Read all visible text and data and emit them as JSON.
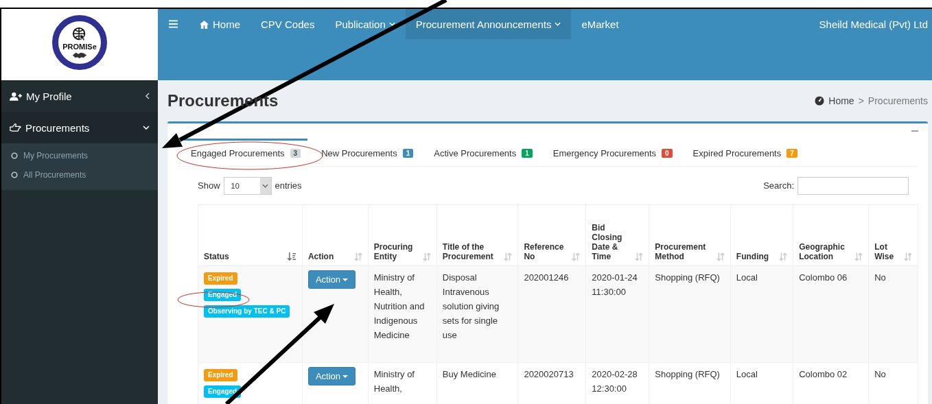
{
  "logo": {
    "text": "PROMISe"
  },
  "nav": {
    "items": [
      {
        "label": "Home",
        "kind": "home",
        "selected": false
      },
      {
        "label": "CPV Codes",
        "kind": "link",
        "selected": false
      },
      {
        "label": "Publication",
        "kind": "dropdown",
        "selected": false
      },
      {
        "label": "Procurement Announcements",
        "kind": "dropdown",
        "selected": true
      },
      {
        "label": "eMarket",
        "kind": "link",
        "selected": false
      }
    ],
    "user": "Sheild Medical (Pvt) Ltd"
  },
  "sidebar": {
    "items": [
      {
        "label": "My Profile",
        "kind": "profile",
        "expanded": false
      },
      {
        "label": "Procurements",
        "kind": "hand",
        "expanded": true,
        "children": [
          {
            "label": "My Procurements"
          },
          {
            "label": "All Procurements"
          }
        ]
      }
    ]
  },
  "page": {
    "title": "Procurements",
    "breadcrumb": [
      "Home",
      "Procurements"
    ],
    "separator": ">"
  },
  "tabs": [
    {
      "label": "Engaged Procurements",
      "count": "3",
      "color": "#d2d6de",
      "selected": true
    },
    {
      "label": "New Procurements",
      "count": "1",
      "color": "#3c8dbc",
      "selected": false
    },
    {
      "label": "Active Procurements",
      "count": "1",
      "color": "#00a65a",
      "selected": false
    },
    {
      "label": "Emergency Procurements",
      "count": "0",
      "color": "#dd4b39",
      "selected": false
    },
    {
      "label": "Expired Procurements",
      "count": "7",
      "color": "#f39c12",
      "selected": false
    }
  ],
  "length_menu": {
    "before": "Show",
    "value": "10",
    "after": "entries"
  },
  "search": {
    "label": "Search:"
  },
  "table": {
    "columns": [
      {
        "label": "Status",
        "sorted": true
      },
      {
        "label": "Action",
        "sorted": false
      },
      {
        "label": "Procuring Entity",
        "sorted": false
      },
      {
        "label": "Title of the Procurement",
        "sorted": false
      },
      {
        "label": "Reference No",
        "sorted": false
      },
      {
        "label": "Bid Closing Date & Time",
        "sorted": false
      },
      {
        "label": "Procurement Method",
        "sorted": false
      },
      {
        "label": "Funding",
        "sorted": false
      },
      {
        "label": "Geographic Location",
        "sorted": false
      },
      {
        "label": "Lot Wise",
        "sorted": false
      }
    ],
    "rows": [
      {
        "status": [
          {
            "label": "Expired",
            "color": "#f39c12"
          },
          {
            "label": "Engaged",
            "color": "#00c0ef"
          },
          {
            "label": "Observing by TEC & PC",
            "color": "#00c0ef"
          }
        ],
        "action": "Action",
        "entity": "Ministry of Health, Nutrition and Indigenous Medicine",
        "title": "Disposal Intravenous solution giving sets for single use",
        "reference": "202001246",
        "closing": "2020-01-24 11:30:00",
        "method": "Shopping (RFQ)",
        "funding": "Local",
        "location": "Colombo 06",
        "lot_wise": "No"
      },
      {
        "status": [
          {
            "label": "Expired",
            "color": "#f39c12"
          },
          {
            "label": "Engaged",
            "color": "#00c0ef"
          }
        ],
        "action": "Action",
        "entity": "Ministry of Health,",
        "title": "Buy Medicine",
        "reference": "2020020713",
        "closing": "2020-02-28 12:30:00",
        "method": "Shopping (RFQ)",
        "funding": "Local",
        "location": "Colombo 02",
        "lot_wise": "No"
      }
    ]
  }
}
